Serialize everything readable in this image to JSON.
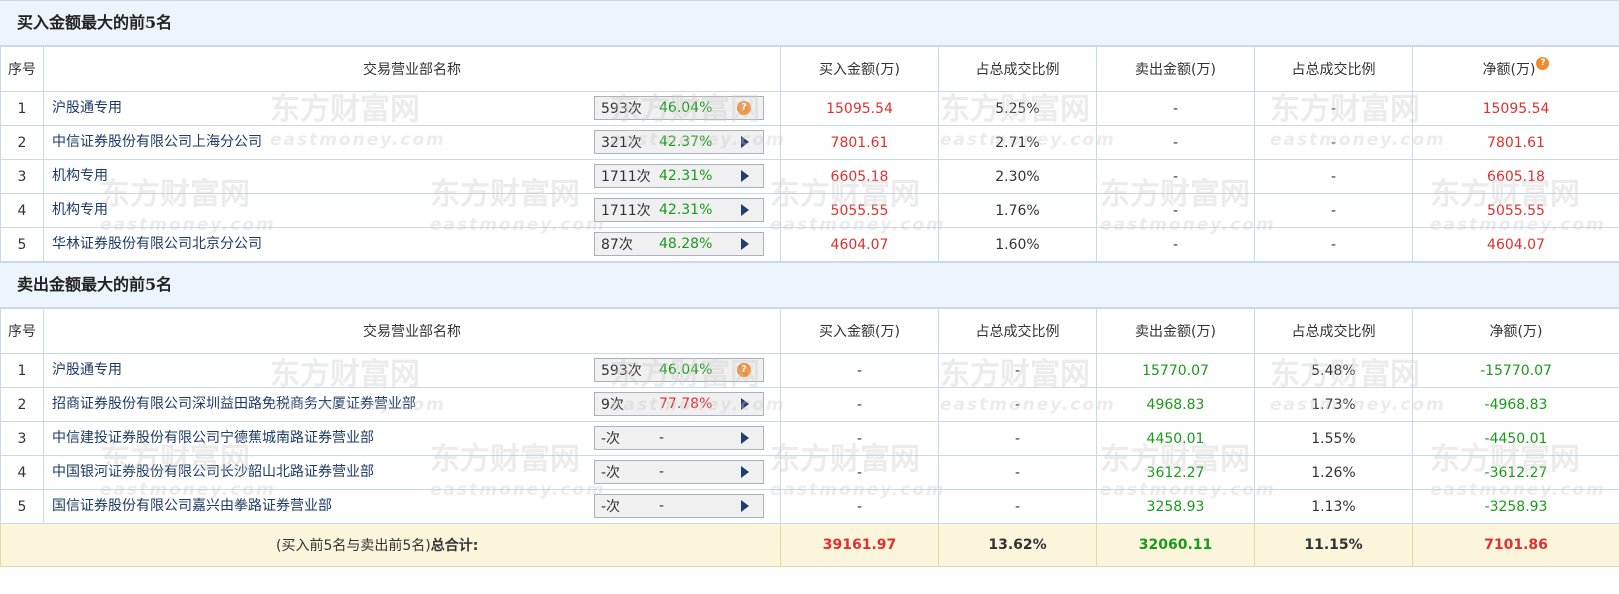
{
  "buy_section": {
    "title": "买入金额最大的前5名",
    "headers": [
      "序号",
      "交易营业部名称",
      "买入金额(万)",
      "占总成交比例",
      "卖出金额(万)",
      "占总成交比例",
      "净额(万)"
    ],
    "rows": [
      {
        "no": "1",
        "name": "沪股通专用",
        "count": "593次",
        "pct": "46.04%",
        "pct_color": "green",
        "icon": "help-icon",
        "buy": "15095.54",
        "buy_ratio": "5.25%",
        "sell": "-",
        "sell_ratio": "-",
        "net": "15095.54"
      },
      {
        "no": "2",
        "name": "中信证券股份有限公司上海分公司",
        "count": "321次",
        "pct": "42.37%",
        "pct_color": "green",
        "icon": "arrow-icon",
        "buy": "7801.61",
        "buy_ratio": "2.71%",
        "sell": "-",
        "sell_ratio": "-",
        "net": "7801.61"
      },
      {
        "no": "3",
        "name": "机构专用",
        "count": "1711次",
        "pct": "42.31%",
        "pct_color": "green",
        "icon": "arrow-icon",
        "buy": "6605.18",
        "buy_ratio": "2.30%",
        "sell": "-",
        "sell_ratio": "-",
        "net": "6605.18"
      },
      {
        "no": "4",
        "name": "机构专用",
        "count": "1711次",
        "pct": "42.31%",
        "pct_color": "green",
        "icon": "arrow-icon",
        "buy": "5055.55",
        "buy_ratio": "1.76%",
        "sell": "-",
        "sell_ratio": "-",
        "net": "5055.55"
      },
      {
        "no": "5",
        "name": "华林证券股份有限公司北京分公司",
        "count": "87次",
        "pct": "48.28%",
        "pct_color": "green",
        "icon": "arrow-icon",
        "buy": "4604.07",
        "buy_ratio": "1.60%",
        "sell": "-",
        "sell_ratio": "-",
        "net": "4604.07"
      }
    ]
  },
  "sell_section": {
    "title": "卖出金额最大的前5名",
    "headers": [
      "序号",
      "交易营业部名称",
      "买入金额(万)",
      "占总成交比例",
      "卖出金额(万)",
      "占总成交比例",
      "净额(万)"
    ],
    "rows": [
      {
        "no": "1",
        "name": "沪股通专用",
        "count": "593次",
        "pct": "46.04%",
        "pct_color": "green",
        "icon": "help-icon",
        "buy": "-",
        "buy_ratio": "-",
        "sell": "15770.07",
        "sell_ratio": "5.48%",
        "net": "-15770.07"
      },
      {
        "no": "2",
        "name": "招商证券股份有限公司深圳益田路免税商务大厦证券营业部",
        "count": "9次",
        "pct": "77.78%",
        "pct_color": "red",
        "icon": "arrow-icon",
        "buy": "-",
        "buy_ratio": "-",
        "sell": "4968.83",
        "sell_ratio": "1.73%",
        "net": "-4968.83"
      },
      {
        "no": "3",
        "name": "中信建投证券股份有限公司宁德蕉城南路证券营业部",
        "count": "-次",
        "pct": "-",
        "pct_color": "plain",
        "icon": "arrow-icon",
        "buy": "-",
        "buy_ratio": "-",
        "sell": "4450.01",
        "sell_ratio": "1.55%",
        "net": "-4450.01"
      },
      {
        "no": "4",
        "name": "中国银河证券股份有限公司长沙韶山北路证券营业部",
        "count": "-次",
        "pct": "-",
        "pct_color": "plain",
        "icon": "arrow-icon",
        "buy": "-",
        "buy_ratio": "-",
        "sell": "3612.27",
        "sell_ratio": "1.26%",
        "net": "-3612.27"
      },
      {
        "no": "5",
        "name": "国信证券股份有限公司嘉兴由拳路证券营业部",
        "count": "-次",
        "pct": "-",
        "pct_color": "plain",
        "icon": "arrow-icon",
        "buy": "-",
        "buy_ratio": "-",
        "sell": "3258.93",
        "sell_ratio": "1.13%",
        "net": "-3258.93"
      }
    ]
  },
  "total": {
    "label_prefix": "(买入前5名与卖出前5名)",
    "label_bold": "总合计:",
    "buy": "39161.97",
    "buy_ratio": "13.62%",
    "sell": "32060.11",
    "sell_ratio": "11.15%",
    "net": "7101.86"
  },
  "net_help_glyph": "?",
  "help_glyph": "?",
  "watermark": {
    "cn": "东方财富网",
    "en": "eastmoney.com"
  },
  "colors": {
    "positive": "#e03030",
    "negative": "#1a9a1a",
    "header_bg": "#eef4fb",
    "total_bg": "#fbf6db",
    "border": "#c9d9ea"
  }
}
